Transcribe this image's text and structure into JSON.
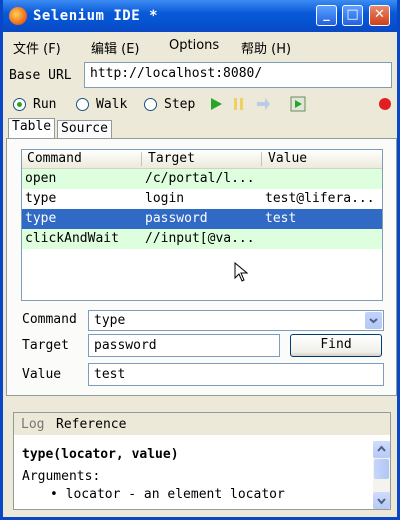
{
  "window": {
    "title": "Selenium IDE *"
  },
  "menu": [
    "文件 (F)",
    "编辑 (E)",
    "Options",
    "帮助 (H)"
  ],
  "base_url": {
    "label": "Base URL",
    "value": "http://localhost:8080/"
  },
  "speed": {
    "run": "Run",
    "walk": "Walk",
    "step": "Step",
    "selected": "run"
  },
  "tabs": {
    "table": "Table",
    "source": "Source"
  },
  "grid": {
    "headers": [
      "Command",
      "Target",
      "Value"
    ],
    "rows": [
      {
        "command": "open",
        "target": "/c/portal/l...",
        "value": ""
      },
      {
        "command": "type",
        "target": "login",
        "value": "test@lifera..."
      },
      {
        "command": "type",
        "target": "password",
        "value": "test"
      },
      {
        "command": "clickAndWait",
        "target": "//input[@va...",
        "value": ""
      }
    ],
    "selected_row": 2
  },
  "editor": {
    "command_label": "Command",
    "command_value": "type",
    "target_label": "Target",
    "target_value": "password",
    "find_label": "Find",
    "value_label": "Value",
    "value_value": "test"
  },
  "bottom": {
    "tab_log": "Log",
    "tab_reference": "Reference",
    "signature": "type(locator, value)",
    "arguments_label": "Arguments:",
    "arg1": "locator - an element locator"
  },
  "colors": {
    "title_blue": "#0a5ad8",
    "selection": "#316ac5",
    "row_tint": "#ddffdd"
  }
}
